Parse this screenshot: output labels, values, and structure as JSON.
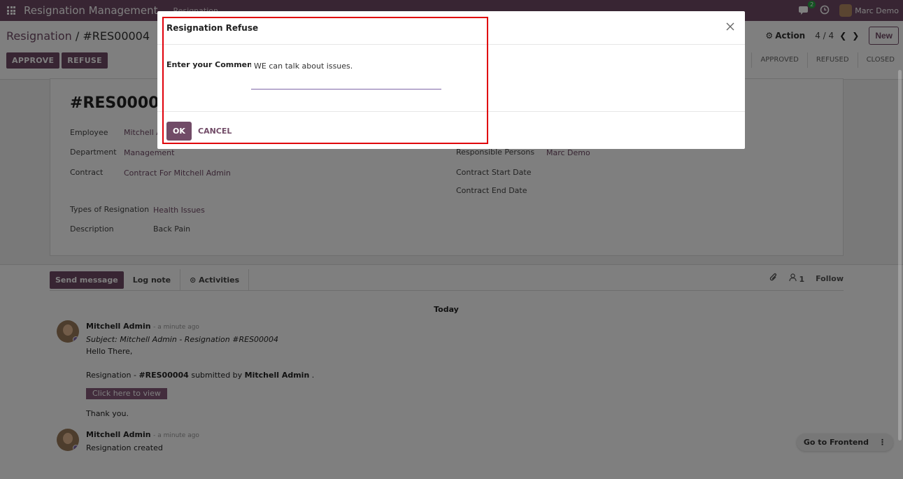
{
  "navbar": {
    "app_name": "Resignation Management",
    "menu_item": "Resignation",
    "chat_badge": "2",
    "user_name": "Marc Demo"
  },
  "control": {
    "breadcrumb_parent": "Resignation",
    "breadcrumb_sep": " / ",
    "breadcrumb_current": "#RES00004",
    "action_label": "Action",
    "pager_value": "4 / 4",
    "new_label": "New",
    "approve_label": "APPROVE",
    "refuse_label": "REFUSE",
    "stages": [
      "APPROVED",
      "REFUSED",
      "CLOSED"
    ]
  },
  "record": {
    "title": "#RES00004",
    "employee_label": "Employee",
    "employee_value": "Mitchell A",
    "department_label": "Department",
    "department_value": "Management",
    "contract_label": "Contract",
    "contract_value": "Contract For Mitchell Admin",
    "responsible_label": "Responsible Persons",
    "responsible_value": "Marc Demo",
    "contract_start_label": "Contract Start Date",
    "contract_end_label": "Contract End Date",
    "type_label": "Types of Resignation",
    "type_value": "Health Issues",
    "description_label": "Description",
    "description_value": "Back Pain"
  },
  "chatter": {
    "send_message": "Send message",
    "log_note": "Log note",
    "activities": "Activities",
    "followers_count": "1",
    "follow_label": "Follow",
    "today_label": "Today",
    "messages": [
      {
        "author": "Mitchell Admin",
        "time": "- a minute ago",
        "subject": "Subject: Mitchell Admin - Resignation #RES00004",
        "greeting": "Hello There,",
        "line_prefix": "Resignation - ",
        "line_ref": "#RES00004",
        "line_mid": " submitted by ",
        "line_user": "Mitchell Admin",
        "line_end": " .",
        "button": "Click here to view",
        "closing": "Thank you."
      },
      {
        "author": "Mitchell Admin",
        "time": "- a minute ago",
        "body": "Resignation created"
      }
    ],
    "go_frontend": "Go to Frontend"
  },
  "modal": {
    "title": "Resignation Refuse",
    "comment_label": "Enter your Comment",
    "comment_value": "WE can talk about issues.",
    "ok_label": "OK",
    "cancel_label": "CANCEL"
  },
  "colors": {
    "brand": "#714b67",
    "highlight": "#e0000b",
    "badge": "#28a745"
  }
}
